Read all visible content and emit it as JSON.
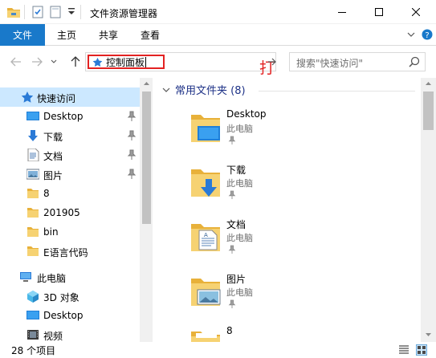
{
  "window": {
    "title": "文件资源管理器"
  },
  "ribbon": {
    "tabs": [
      "文件",
      "主页",
      "共享",
      "查看"
    ]
  },
  "address": {
    "value": "控制面板",
    "annotation": "打字输入"
  },
  "search": {
    "placeholder": "搜索\"快速访问\""
  },
  "nav": {
    "quick_access": "快速访问",
    "pinned": [
      "Desktop",
      "下载",
      "文档",
      "图片"
    ],
    "recent": [
      "8",
      "201905",
      "bin",
      "E语言代码"
    ],
    "this_pc": "此电脑",
    "pc_items": [
      "3D 对象",
      "Desktop",
      "视频"
    ]
  },
  "content": {
    "group_title": "常用文件夹 (8)",
    "folders": [
      {
        "name": "Desktop",
        "location": "此电脑"
      },
      {
        "name": "下载",
        "location": "此电脑"
      },
      {
        "name": "文档",
        "location": "此电脑"
      },
      {
        "name": "图片",
        "location": "此电脑"
      },
      {
        "name": "8",
        "location": ""
      }
    ]
  },
  "status": {
    "item_count": "28 个项目"
  },
  "colors": {
    "accent": "#1979ca",
    "selected": "#cce8ff",
    "annotation": "#e32222",
    "group_header": "#1e3287"
  }
}
